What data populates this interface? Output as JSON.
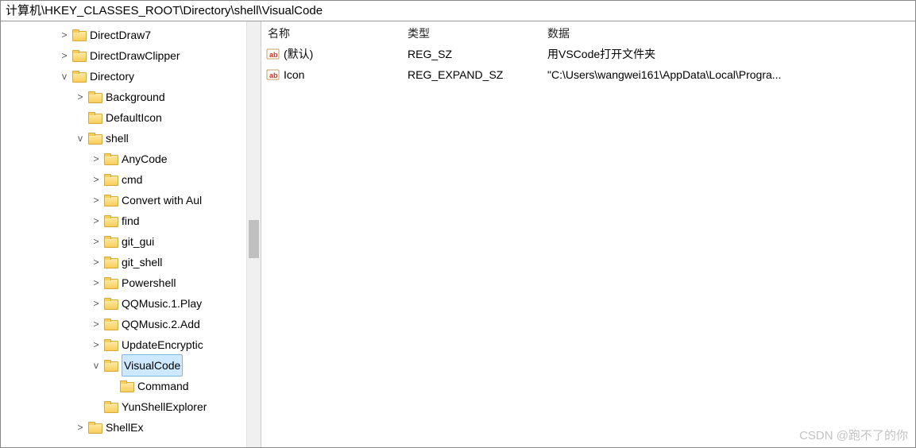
{
  "address": "计算机\\HKEY_CLASSES_ROOT\\Directory\\shell\\VisualCode",
  "columns": {
    "name": "名称",
    "type": "类型",
    "data": "数据"
  },
  "values": [
    {
      "name": "(默认)",
      "type": "REG_SZ",
      "data": "用VSCode打开文件夹"
    },
    {
      "name": "Icon",
      "type": "REG_EXPAND_SZ",
      "data": "\"C:\\Users\\wangwei161\\AppData\\Local\\Progra..."
    }
  ],
  "tree": {
    "n0": {
      "tw": ">",
      "label": "DirectDraw7"
    },
    "n1": {
      "tw": ">",
      "label": "DirectDrawClipper"
    },
    "n2": {
      "tw": "v",
      "label": "Directory"
    },
    "n3": {
      "tw": ">",
      "label": "Background"
    },
    "n4": {
      "tw": "",
      "label": "DefaultIcon"
    },
    "n5": {
      "tw": "v",
      "label": "shell"
    },
    "n6": {
      "tw": ">",
      "label": "AnyCode"
    },
    "n7": {
      "tw": ">",
      "label": "cmd"
    },
    "n8": {
      "tw": ">",
      "label": "Convert with Aul"
    },
    "n9": {
      "tw": ">",
      "label": "find"
    },
    "n10": {
      "tw": ">",
      "label": "git_gui"
    },
    "n11": {
      "tw": ">",
      "label": "git_shell"
    },
    "n12": {
      "tw": ">",
      "label": "Powershell"
    },
    "n13": {
      "tw": ">",
      "label": "QQMusic.1.Play"
    },
    "n14": {
      "tw": ">",
      "label": "QQMusic.2.Add"
    },
    "n15": {
      "tw": ">",
      "label": "UpdateEncryptic"
    },
    "n16": {
      "tw": "v",
      "label": "VisualCode"
    },
    "n17": {
      "tw": "",
      "label": "Command"
    },
    "n18": {
      "tw": "",
      "label": "YunShellExplorer"
    },
    "n19": {
      "tw": ">",
      "label": "ShellEx"
    }
  },
  "watermark": "CSDN @跑不了的你"
}
